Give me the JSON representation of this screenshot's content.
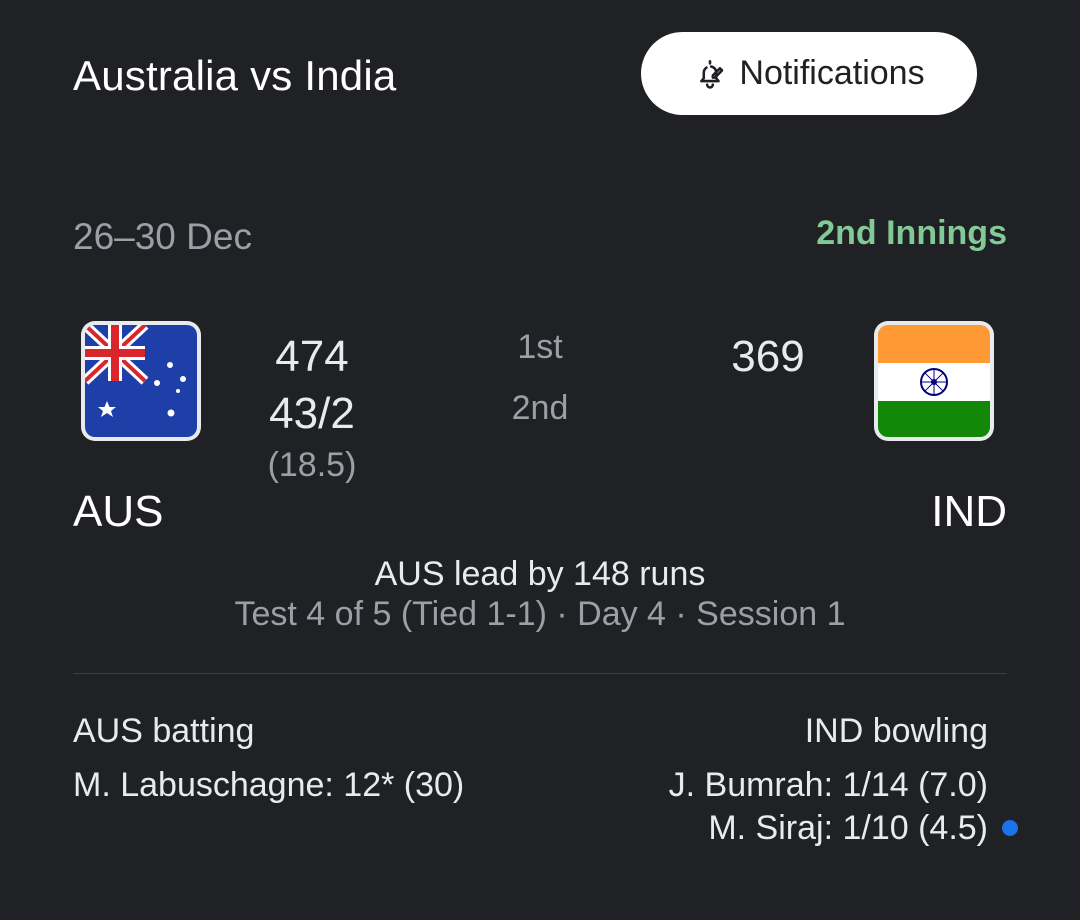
{
  "header": {
    "title": "Australia vs India",
    "notifications_label": "Notifications"
  },
  "match": {
    "dates": "26–30 Dec",
    "innings_status": "2nd Innings",
    "innings_labels": [
      "1st",
      "2nd"
    ],
    "lead_text": "AUS lead by 148 runs",
    "series_status": "Test 4 of 5 (Tied 1-1) · Day 4 · Session 1"
  },
  "teams": {
    "home": {
      "code": "AUS",
      "flag_icon": "australia-flag-icon",
      "first_innings": "474",
      "second_innings": "43/2",
      "overs": "(18.5)"
    },
    "away": {
      "code": "IND",
      "flag_icon": "india-flag-icon",
      "first_innings": "369"
    }
  },
  "batting": {
    "heading": "AUS batting",
    "players": [
      "M. Labuschagne: 12* (30)"
    ]
  },
  "bowling": {
    "heading": "IND bowling",
    "players": [
      "J. Bumrah: 1/14 (7.0)",
      "M. Siraj: 1/10 (4.5)"
    ]
  },
  "colors": {
    "background": "#202124",
    "accent_green": "#81c995",
    "active_dot": "#1a73e8",
    "text_secondary": "#9aa0a6"
  }
}
